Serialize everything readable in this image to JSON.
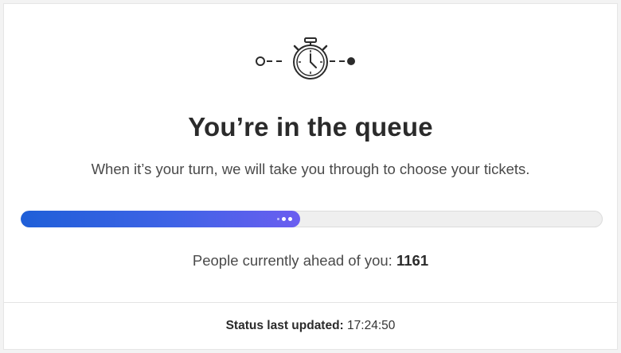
{
  "icons": {
    "queue": "stopwatch-icon"
  },
  "queue": {
    "title": "You’re in the queue",
    "subtitle": "When it’s your turn, we will take you through to choose your tickets.",
    "progress_fraction": 0.48,
    "ahead_label": "People currently ahead of you:",
    "ahead_count": "1161"
  },
  "status": {
    "label": "Status last updated:",
    "time": "17:24:50"
  },
  "colors": {
    "progress_start": "#1f5fd8",
    "progress_end": "#6b5ef0",
    "track": "#efefef"
  }
}
